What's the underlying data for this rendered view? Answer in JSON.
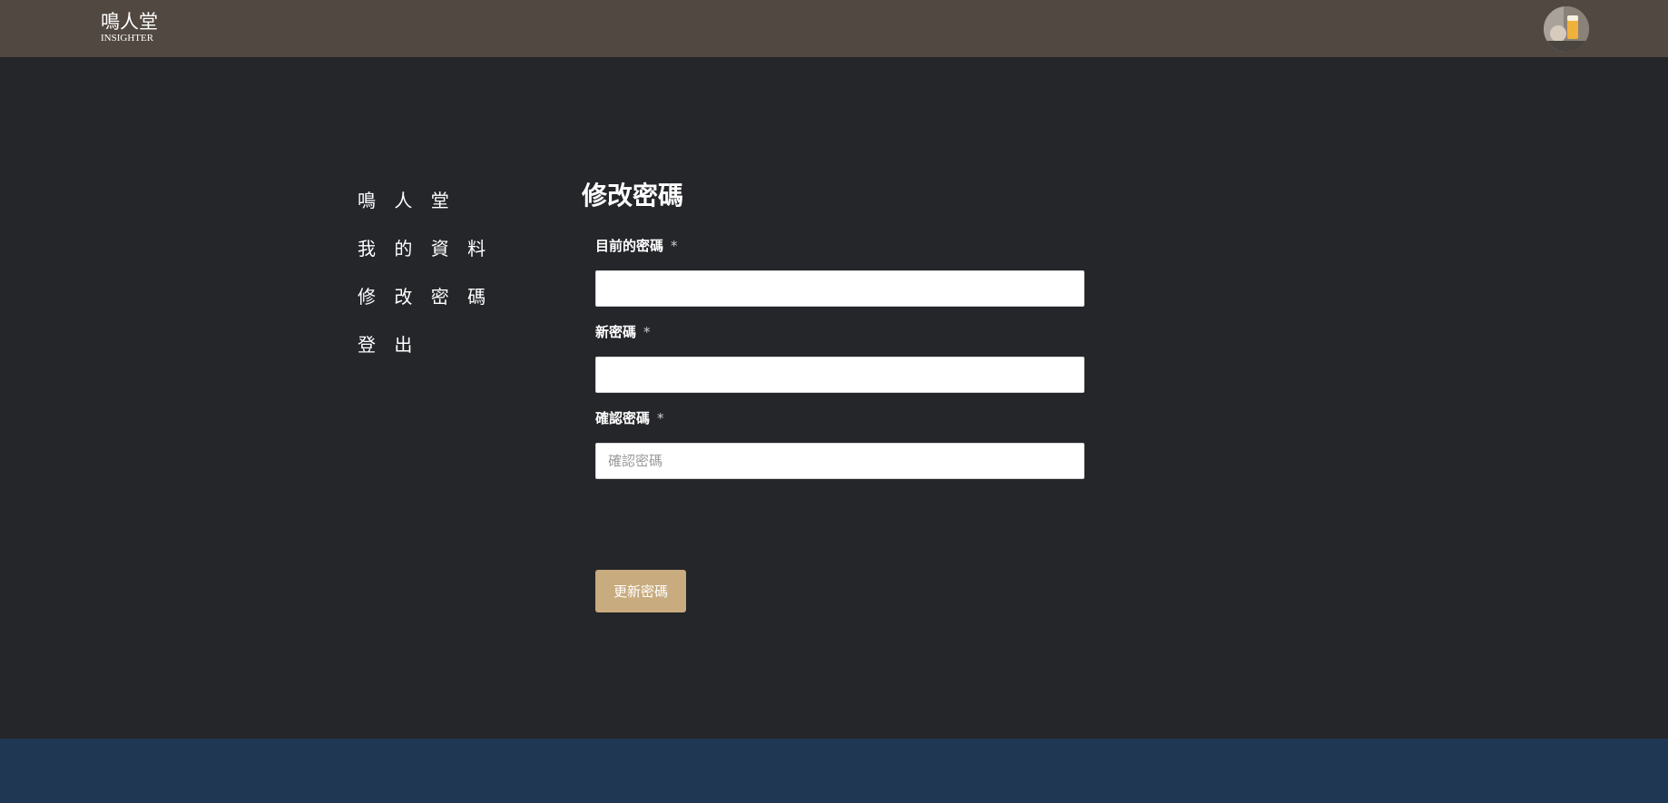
{
  "header": {
    "logo_cn": "鳴人堂",
    "logo_en": "INSIGHTER",
    "avatar_icon": "user-avatar"
  },
  "sidebar": {
    "items": [
      {
        "label": "鳴 人 堂"
      },
      {
        "label": "我 的 資 料"
      },
      {
        "label": "修 改 密 碼"
      },
      {
        "label": "登 出"
      }
    ]
  },
  "form": {
    "title": "修改密碼",
    "required_mark": "*",
    "fields": [
      {
        "label": "目前的密碼",
        "value": "",
        "placeholder": ""
      },
      {
        "label": "新密碼",
        "value": "",
        "placeholder": ""
      },
      {
        "label": "確認密碼",
        "value": "",
        "placeholder": "確認密碼"
      }
    ],
    "submit_label": "更新密碼"
  },
  "colors": {
    "topbar": "#514841",
    "background": "#25262a",
    "accent_button": "#c8ab7e",
    "footer": "#1f3752"
  }
}
